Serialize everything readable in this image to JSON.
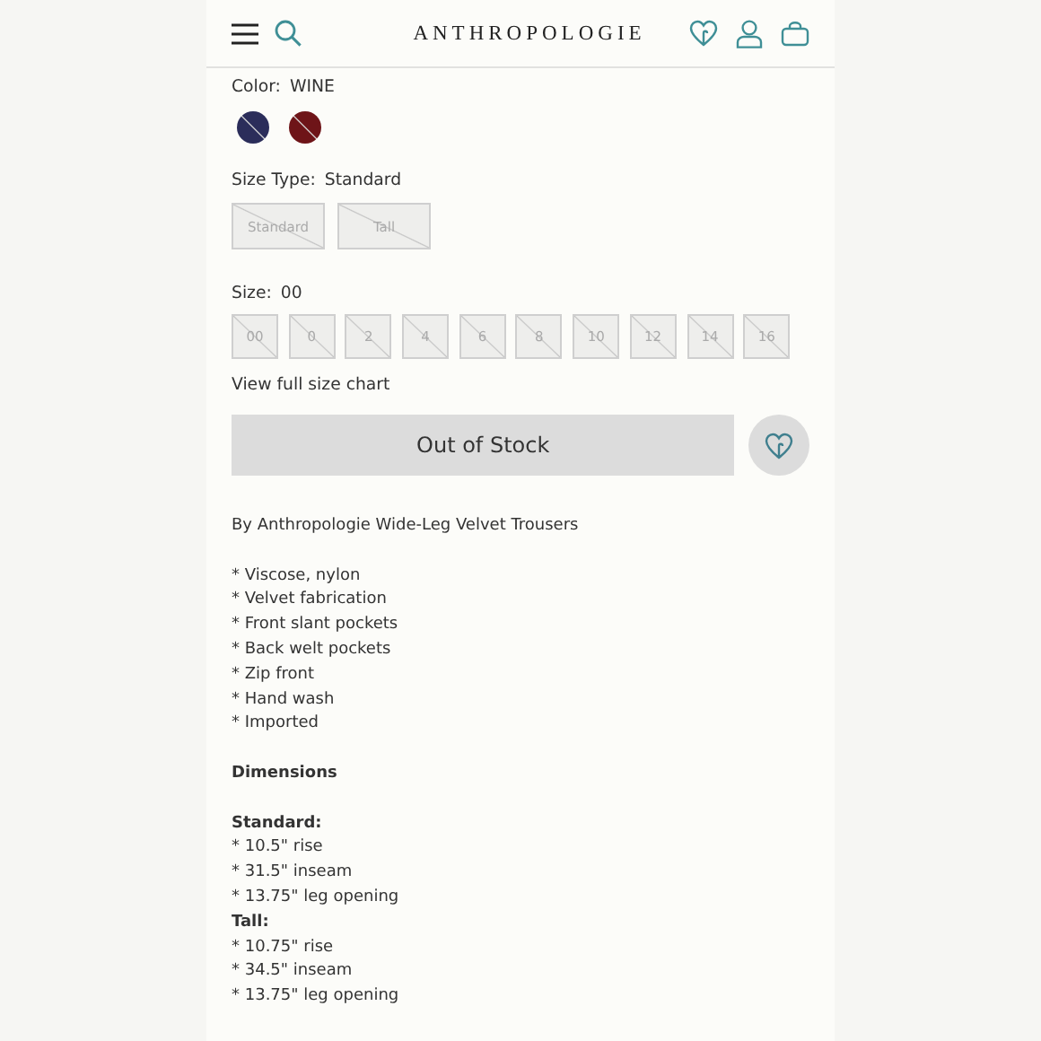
{
  "header": {
    "logo": "ANTHROPOLOGIE"
  },
  "color": {
    "label": "Color:",
    "value": "WINE",
    "swatches": [
      {
        "color": "#2b2d5a",
        "available": false
      },
      {
        "color": "#6e1418",
        "available": false
      }
    ]
  },
  "size_type": {
    "label": "Size Type:",
    "value": "Standard",
    "options": [
      {
        "label": "Standard",
        "available": false
      },
      {
        "label": "Tall",
        "available": false
      }
    ]
  },
  "size": {
    "label": "Size:",
    "value": "00",
    "options": [
      {
        "label": "00",
        "available": false
      },
      {
        "label": "0",
        "available": false
      },
      {
        "label": "2",
        "available": false
      },
      {
        "label": "4",
        "available": false
      },
      {
        "label": "6",
        "available": false
      },
      {
        "label": "8",
        "available": false
      },
      {
        "label": "10",
        "available": false
      },
      {
        "label": "12",
        "available": false
      },
      {
        "label": "14",
        "available": false
      },
      {
        "label": "16",
        "available": false
      }
    ]
  },
  "size_chart_link": "View full size chart",
  "add_button": {
    "label": "Out of Stock",
    "disabled": true
  },
  "description": {
    "intro": "By Anthropologie Wide-Leg Velvet Trousers",
    "features": [
      "* Viscose, nylon",
      "* Velvet fabrication",
      "* Front slant pockets",
      "* Back welt pockets",
      "* Zip front",
      "* Hand wash",
      "* Imported"
    ],
    "dimensions_heading": "Dimensions",
    "groups": [
      {
        "title": "Standard:",
        "lines": [
          "* 10.5\" rise",
          "* 31.5\" inseam",
          "* 13.75\" leg opening"
        ]
      },
      {
        "title": "Tall:",
        "lines": [
          "* 10.75\" rise",
          "* 34.5\" inseam",
          "* 13.75\" leg opening"
        ]
      }
    ]
  }
}
